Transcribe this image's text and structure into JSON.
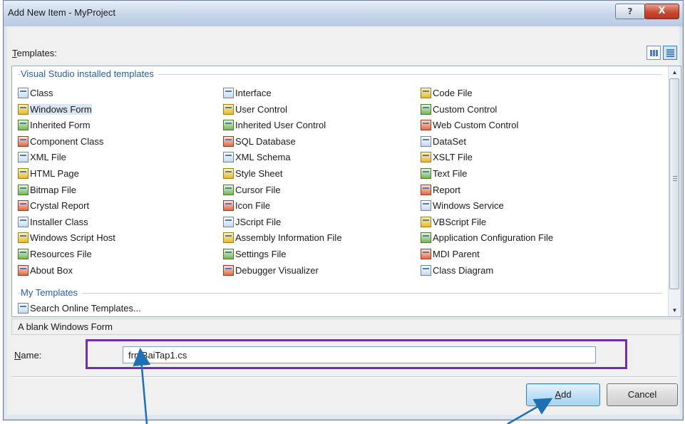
{
  "window": {
    "title": "Add New Item - MyProject",
    "help_label": "?",
    "close_label": "X"
  },
  "templates": {
    "label_underlined": "T",
    "label_rest": "emplates:",
    "view_buttons": [
      "large-icons-view",
      "small-icons-view"
    ]
  },
  "groups": {
    "installed": "Visual Studio installed templates",
    "my": "My Templates"
  },
  "items": {
    "col1": [
      {
        "label": "Class",
        "icon": "class-icon"
      },
      {
        "label": "Windows Form",
        "icon": "windows-form-icon"
      },
      {
        "label": "Inherited Form",
        "icon": "inherited-form-icon"
      },
      {
        "label": "Component Class",
        "icon": "component-class-icon"
      },
      {
        "label": "XML File",
        "icon": "xml-file-icon"
      },
      {
        "label": "HTML Page",
        "icon": "html-page-icon"
      },
      {
        "label": "Bitmap File",
        "icon": "bitmap-file-icon"
      },
      {
        "label": "Crystal Report",
        "icon": "crystal-report-icon"
      },
      {
        "label": "Installer Class",
        "icon": "installer-class-icon"
      },
      {
        "label": "Windows Script Host",
        "icon": "windows-script-host-icon"
      },
      {
        "label": "Resources File",
        "icon": "resources-file-icon"
      },
      {
        "label": "About Box",
        "icon": "about-box-icon"
      }
    ],
    "col2": [
      {
        "label": "Interface",
        "icon": "interface-icon"
      },
      {
        "label": "User Control",
        "icon": "user-control-icon"
      },
      {
        "label": "Inherited User Control",
        "icon": "inherited-user-control-icon"
      },
      {
        "label": "SQL Database",
        "icon": "sql-database-icon"
      },
      {
        "label": "XML Schema",
        "icon": "xml-schema-icon"
      },
      {
        "label": "Style Sheet",
        "icon": "style-sheet-icon"
      },
      {
        "label": "Cursor File",
        "icon": "cursor-file-icon"
      },
      {
        "label": "Icon File",
        "icon": "icon-file-icon"
      },
      {
        "label": "JScript File",
        "icon": "jscript-file-icon"
      },
      {
        "label": "Assembly Information File",
        "icon": "assembly-info-icon"
      },
      {
        "label": "Settings File",
        "icon": "settings-file-icon"
      },
      {
        "label": "Debugger Visualizer",
        "icon": "debugger-visualizer-icon"
      }
    ],
    "col3": [
      {
        "label": "Code File",
        "icon": "code-file-icon"
      },
      {
        "label": "Custom Control",
        "icon": "custom-control-icon"
      },
      {
        "label": "Web Custom Control",
        "icon": "web-custom-control-icon"
      },
      {
        "label": "DataSet",
        "icon": "dataset-icon"
      },
      {
        "label": "XSLT File",
        "icon": "xslt-file-icon"
      },
      {
        "label": "Text File",
        "icon": "text-file-icon"
      },
      {
        "label": "Report",
        "icon": "report-icon"
      },
      {
        "label": "Windows Service",
        "icon": "windows-service-icon"
      },
      {
        "label": "VBScript File",
        "icon": "vbscript-file-icon"
      },
      {
        "label": "Application Configuration File",
        "icon": "app-config-icon"
      },
      {
        "label": "MDI Parent",
        "icon": "mdi-parent-icon"
      },
      {
        "label": "Class Diagram",
        "icon": "class-diagram-icon"
      }
    ],
    "my": [
      {
        "label": "Search Online Templates...",
        "icon": "search-online-icon"
      }
    ],
    "selected": "Windows Form"
  },
  "description": "A blank Windows Form",
  "name_field": {
    "label_underlined": "N",
    "label_rest": "ame:",
    "value": "frmBaiTap1.cs"
  },
  "buttons": {
    "add_underlined": "A",
    "add_rest": "dd",
    "cancel": "Cancel"
  },
  "colors": {
    "highlight_box": "#7030a0",
    "annotation_arrow": "#1f6fb5",
    "group_header": "#2a5ca8",
    "selected_item_bg": "#dbe6f4"
  }
}
